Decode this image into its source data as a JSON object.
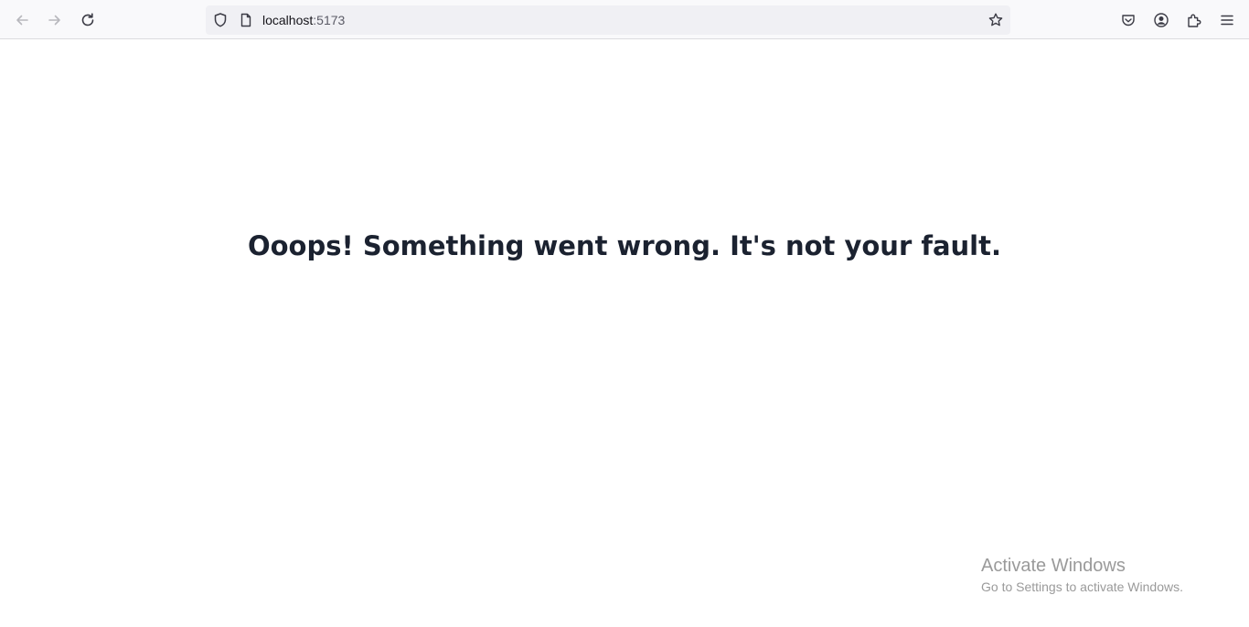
{
  "browser": {
    "url_host": "localhost",
    "url_port": ":5173",
    "icons": {
      "back": "back-arrow-icon",
      "forward": "forward-arrow-icon",
      "reload": "reload-icon",
      "tracking": "shield-icon",
      "page": "page-icon",
      "bookmark": "star-icon",
      "pocket": "pocket-icon",
      "account": "account-icon",
      "extensions": "extensions-icon",
      "menu": "hamburger-menu-icon"
    }
  },
  "page": {
    "error_message": "Ooops! Something went wrong. It's not your fault."
  },
  "watermark": {
    "title": "Activate Windows",
    "subtitle": "Go to Settings to activate Windows."
  },
  "colors": {
    "heading": "#1b2230",
    "toolbar_bg": "#f9f9fb",
    "urlbar_bg": "#f0f0f4",
    "watermark": "#9a9a9a"
  }
}
